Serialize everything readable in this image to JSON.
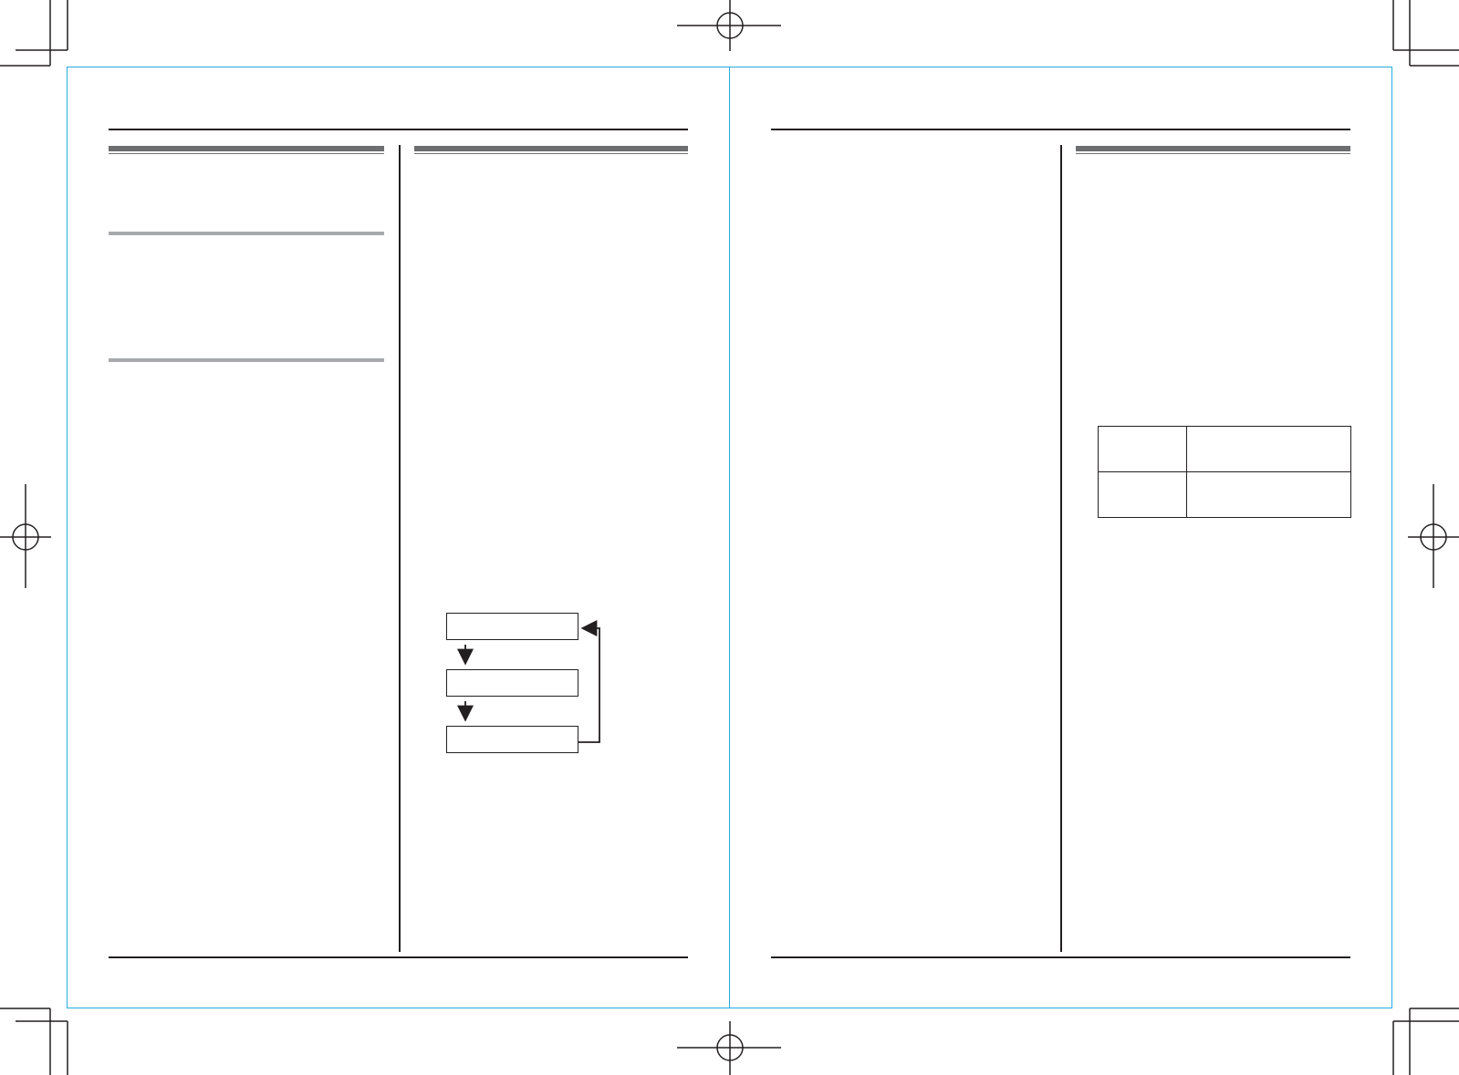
{
  "document": {
    "pages": [
      {
        "columns": [
          {
            "headings": [],
            "sub_sections": []
          },
          {
            "headings": [],
            "flow_diagram": {
              "steps": []
            }
          }
        ]
      },
      {
        "columns": [
          {
            "headings": []
          },
          {
            "headings": [],
            "table": {
              "rows": [
                [
                  "",
                  ""
                ],
                [
                  "",
                  ""
                ]
              ]
            }
          }
        ]
      }
    ]
  },
  "colors": {
    "trim_border": "#27aae1",
    "heading_bar": "#6d6e70",
    "sub_rule": "#a7a9ac",
    "rule": "#231f20",
    "crop_marks": "#231f20"
  }
}
